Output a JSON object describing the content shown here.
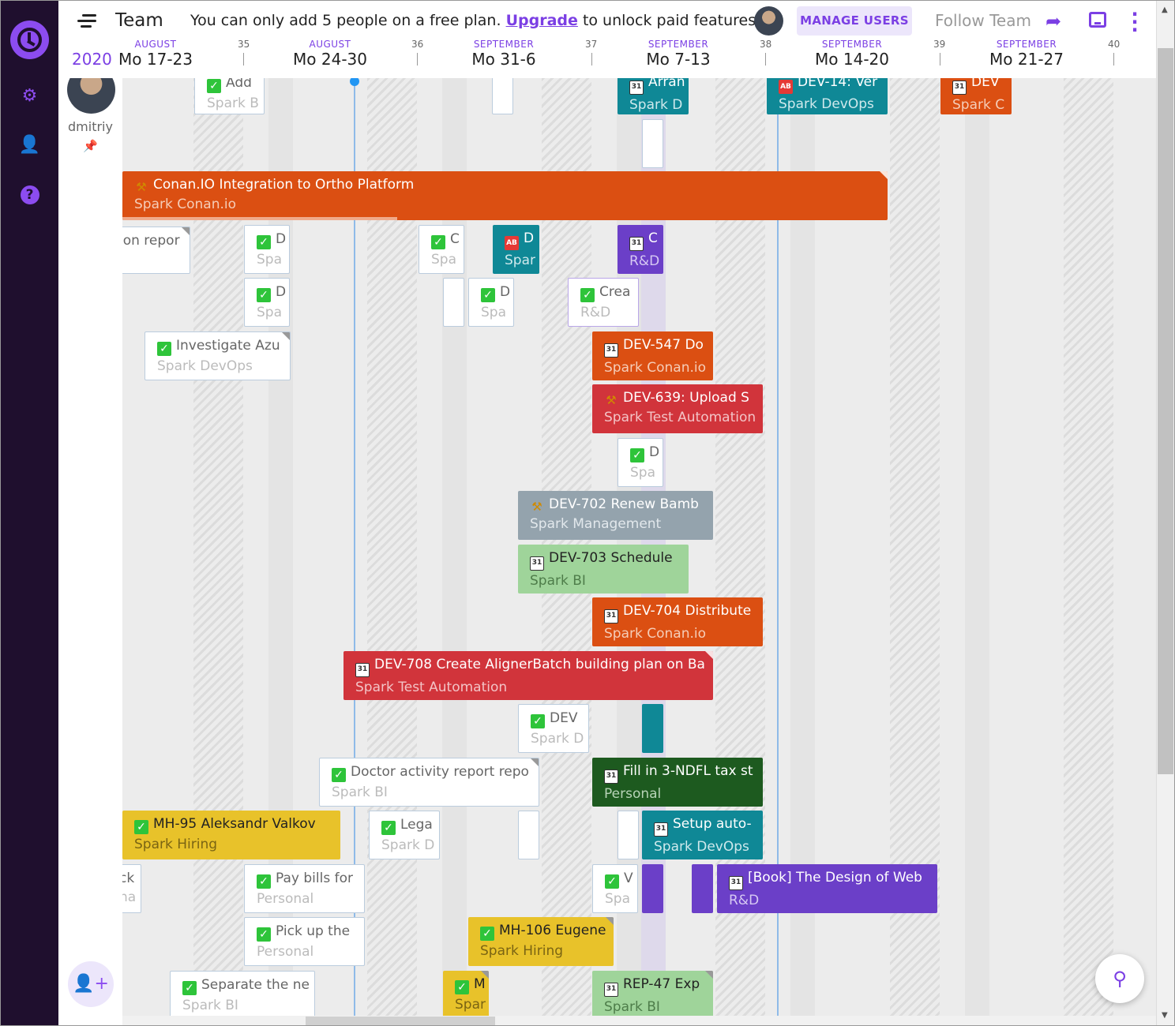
{
  "header": {
    "team_title": "Team",
    "promo_before": "You can only add 5 people on a free plan.",
    "promo_link": "Upgrade",
    "promo_after": "to unlock paid features!",
    "manage_users": "MANAGE USERS",
    "follow_team": "Follow Team"
  },
  "timeline": {
    "year": "2020",
    "weeks": [
      {
        "month": "AUGUST",
        "range": "Mo 17-23",
        "num": "35"
      },
      {
        "month": "AUGUST",
        "range": "Mo 24-30",
        "num": "36"
      },
      {
        "month": "SEPTEMBER",
        "range": "Mo 31-6",
        "num": "37"
      },
      {
        "month": "SEPTEMBER",
        "range": "Mo 7-13",
        "num": "38"
      },
      {
        "month": "SEPTEMBER",
        "range": "Mo 14-20",
        "num": "39"
      },
      {
        "month": "SEPTEMBER",
        "range": "Mo 21-27",
        "num": "40"
      }
    ]
  },
  "user": {
    "name": "dmitriy"
  },
  "icons": {
    "nav": [
      "logo-icon",
      "settings-icon",
      "users-icon",
      "help-icon"
    ],
    "header": [
      "menu-icon",
      "share-icon",
      "inbox-icon",
      "more-icon"
    ],
    "bottom": [
      "add-user-icon",
      "zoom-icon"
    ]
  },
  "colors": {
    "accent": "#7b3fe4",
    "rail": "#1f0f2e",
    "teal": "#0f8896",
    "orange": "#db4f12",
    "red": "#d1343b",
    "gray": "#94a3ad",
    "light_green": "#9fd49a",
    "dark_green": "#1d5a1f",
    "yellow": "#e8c22a",
    "purple": "#6b3fc8"
  },
  "tasks": [
    {
      "title": "Add",
      "project": "Spark B",
      "icon": "check"
    },
    {
      "title": "Arran",
      "project": "Spark D",
      "icon": "cal"
    },
    {
      "title": "DEV-14: Ver",
      "project": "Spark DevOps",
      "icon": "ab"
    },
    {
      "title": "DEV",
      "project": "Spark C",
      "icon": "cal"
    },
    {
      "title": "Conan.IO Integration to Ortho Platform",
      "project": "Spark Conan.io",
      "icon": "tool"
    },
    {
      "title": "ion repor",
      "project": "",
      "icon": ""
    },
    {
      "title": "D",
      "project": "Spa",
      "icon": "check"
    },
    {
      "title": "C",
      "project": "Spa",
      "icon": "check"
    },
    {
      "title": "D",
      "project": "Spar",
      "icon": "ab"
    },
    {
      "title": "C",
      "project": "R&D",
      "icon": "cal"
    },
    {
      "title": "D",
      "project": "Spa",
      "icon": "check"
    },
    {
      "title": "D",
      "project": "Spa",
      "icon": "check"
    },
    {
      "title": "Crea",
      "project": "R&D",
      "icon": "check"
    },
    {
      "title": "Investigate Azu",
      "project": "Spark DevOps",
      "icon": "check"
    },
    {
      "title": "DEV-547 Do",
      "project": "Spark Conan.io",
      "icon": "cal"
    },
    {
      "title": "DEV-639: Upload S",
      "project": "Spark Test Automation",
      "icon": "tool"
    },
    {
      "title": "D",
      "project": "Spa",
      "icon": "check"
    },
    {
      "title": "DEV-702 Renew Bamb",
      "project": "Spark Management",
      "icon": "tool"
    },
    {
      "title": "DEV-703 Schedule",
      "project": "Spark BI",
      "icon": "cal"
    },
    {
      "title": "DEV-704 Distribute",
      "project": "Spark Conan.io",
      "icon": "cal"
    },
    {
      "title": "DEV-708 Create AlignerBatch building plan on Ba",
      "project": "Spark Test Automation",
      "icon": "cal"
    },
    {
      "title": "DEV",
      "project": "Spark D",
      "icon": "check"
    },
    {
      "title": "Doctor activity report repo",
      "project": "Spark BI",
      "icon": "check"
    },
    {
      "title": "Fill in 3-NDFL tax st",
      "project": "Personal",
      "icon": "cal"
    },
    {
      "title": "MH-95 Aleksandr Valkov",
      "project": "Spark Hiring",
      "icon": "check"
    },
    {
      "title": "Lega",
      "project": "Spark D",
      "icon": "check"
    },
    {
      "title": "Setup auto-",
      "project": "Spark DevOps",
      "icon": "cal"
    },
    {
      "title": "ck",
      "project": "na",
      "icon": ""
    },
    {
      "title": "Pay bills for",
      "project": "Personal",
      "icon": "check"
    },
    {
      "title": "V",
      "project": "Spa",
      "icon": "check"
    },
    {
      "title": "[Book] The Design of Web",
      "project": "R&D",
      "icon": "cal"
    },
    {
      "title": "Pick up the",
      "project": "Personal",
      "icon": "check"
    },
    {
      "title": "MH-106 Eugene",
      "project": "Spark Hiring",
      "icon": "check"
    },
    {
      "title": "Separate the ne",
      "project": "Spark BI",
      "icon": "check"
    },
    {
      "title": "M",
      "project": "Spar",
      "icon": "check"
    },
    {
      "title": "REP-47 Exp",
      "project": "Spark BI",
      "icon": "cal"
    }
  ]
}
